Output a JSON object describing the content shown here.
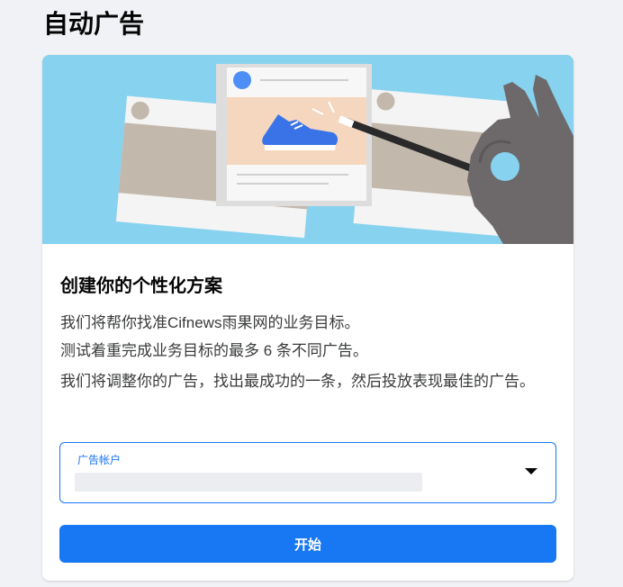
{
  "page": {
    "title": "自动广告"
  },
  "hero": {
    "illustration": "ad-cards-with-magic-wand"
  },
  "section": {
    "title": "创建你的个性化方案",
    "lines": [
      "我们将帮你找准Cifnews雨果网的业务目标。",
      "测试着重完成业务目标的最多 6 条不同广告。",
      "我们将调整你的广告，找出最成功的一条，然后投放表现最佳的广告。"
    ]
  },
  "ad_account_select": {
    "label": "广告帐户",
    "value": "",
    "icon": "caret-down-icon"
  },
  "start_button": {
    "label": "开始"
  },
  "colors": {
    "accent": "#1877f2",
    "hero_background": "#86d2ef"
  }
}
